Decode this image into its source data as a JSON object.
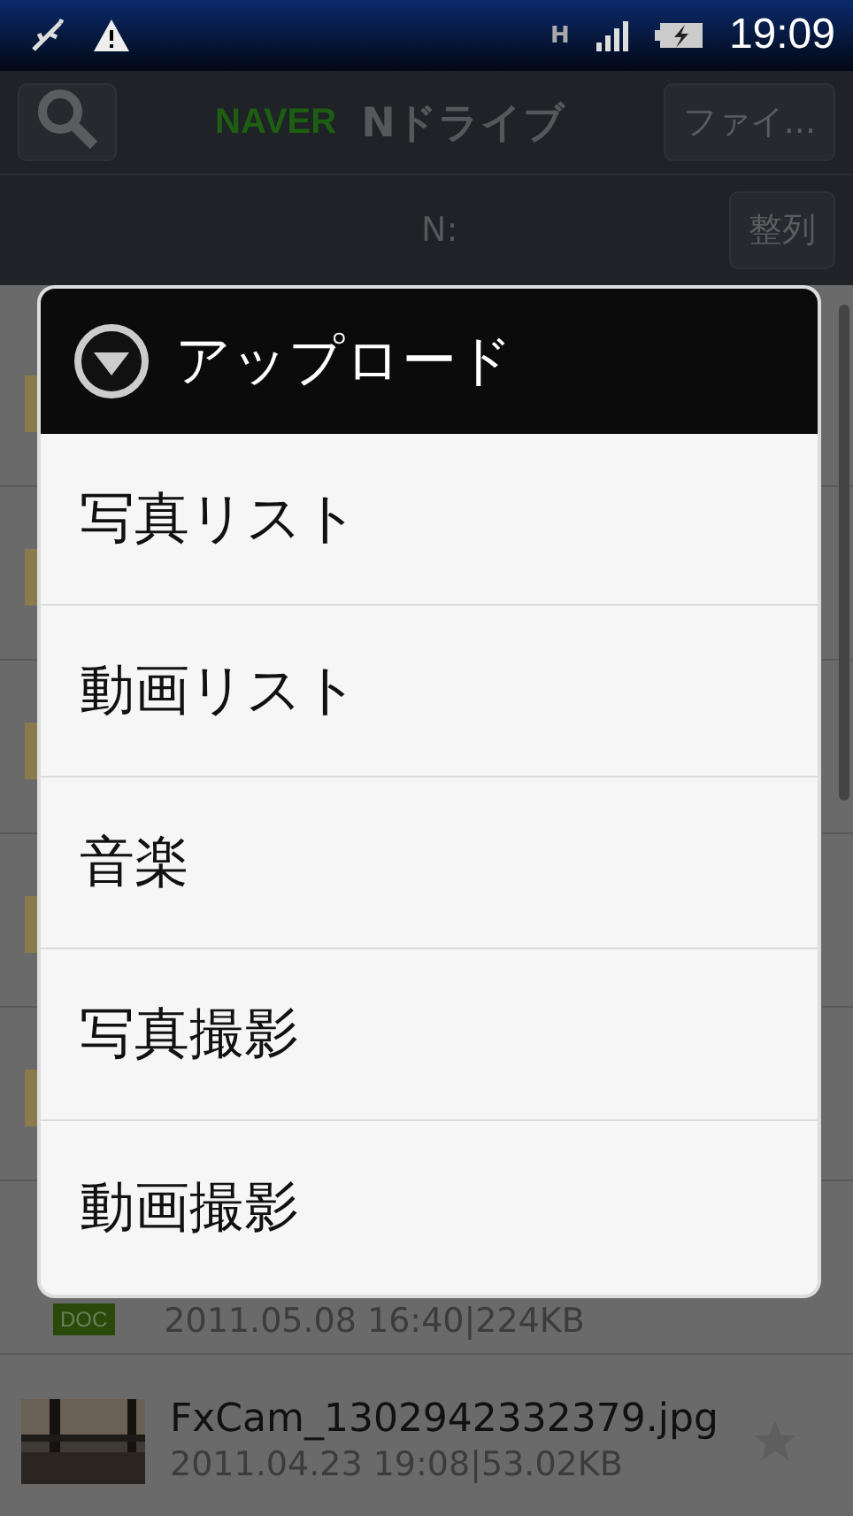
{
  "status_bar": {
    "time": "19:09",
    "network": "H"
  },
  "header": {
    "logo": "NAVER",
    "title": "Nドライブ",
    "menu_button": "ファイ..."
  },
  "path_bar": {
    "path": "N:",
    "sort_button": "整列"
  },
  "files": [
    {
      "kind": "folder"
    },
    {
      "kind": "folder"
    },
    {
      "kind": "folder"
    },
    {
      "kind": "folder"
    },
    {
      "kind": "folder"
    },
    {
      "kind": "doc",
      "badge": "DOC",
      "meta": "2011.05.08 16:40|224KB"
    },
    {
      "name": "FxCam_1302942332379.jpg",
      "meta": "2011.04.23 19:08|53.02KB"
    }
  ],
  "dialog": {
    "title": "アップロード",
    "items": [
      "写真リスト",
      "動画リスト",
      "音楽",
      "写真撮影",
      "動画撮影"
    ]
  }
}
